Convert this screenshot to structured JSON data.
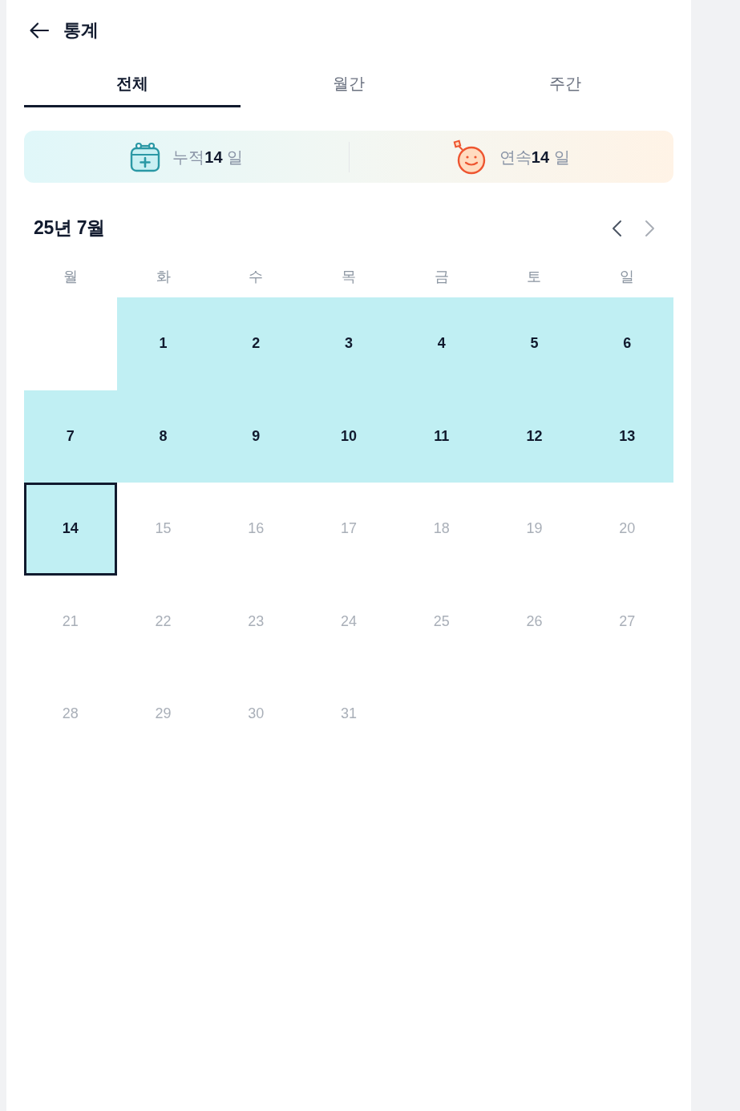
{
  "header": {
    "title": "통계"
  },
  "tabs": [
    {
      "label": "전체",
      "selected": true
    },
    {
      "label": "월간",
      "selected": false
    },
    {
      "label": "주간",
      "selected": false
    }
  ],
  "stats": [
    {
      "kind": "total",
      "text": "누적**14** 일"
    },
    {
      "kind": "streak",
      "text": "연속**14** 일"
    }
  ],
  "calendar": {
    "title": "25년 7월",
    "prev_button": {
      "disabled": false
    },
    "next_button": {
      "disabled": true
    },
    "weekdays": [
      "월",
      "화",
      "수",
      "목",
      "금",
      "토",
      "일"
    ],
    "cells": [
      {
        "kind": "blank"
      },
      {
        "kind": "day",
        "label": "1",
        "done": true,
        "today": false,
        "disabled": false
      },
      {
        "kind": "day",
        "label": "2",
        "done": true,
        "today": false,
        "disabled": false
      },
      {
        "kind": "day",
        "label": "3",
        "done": true,
        "today": false,
        "disabled": false
      },
      {
        "kind": "day",
        "label": "4",
        "done": true,
        "today": false,
        "disabled": false
      },
      {
        "kind": "day",
        "label": "5",
        "done": true,
        "today": false,
        "disabled": false
      },
      {
        "kind": "day",
        "label": "6",
        "done": true,
        "today": false,
        "disabled": false
      },
      {
        "kind": "day",
        "label": "7",
        "done": true,
        "today": false,
        "disabled": false
      },
      {
        "kind": "day",
        "label": "8",
        "done": true,
        "today": false,
        "disabled": false
      },
      {
        "kind": "day",
        "label": "9",
        "done": true,
        "today": false,
        "disabled": false
      },
      {
        "kind": "day",
        "label": "10",
        "done": true,
        "today": false,
        "disabled": false
      },
      {
        "kind": "day",
        "label": "11",
        "done": true,
        "today": false,
        "disabled": false
      },
      {
        "kind": "day",
        "label": "12",
        "done": true,
        "today": false,
        "disabled": false
      },
      {
        "kind": "day",
        "label": "13",
        "done": true,
        "today": false,
        "disabled": false
      },
      {
        "kind": "day",
        "label": "14",
        "done": true,
        "today": true,
        "disabled": false
      },
      {
        "kind": "day",
        "label": "15",
        "done": false,
        "today": false,
        "disabled": true
      },
      {
        "kind": "day",
        "label": "16",
        "done": false,
        "today": false,
        "disabled": true
      },
      {
        "kind": "day",
        "label": "17",
        "done": false,
        "today": false,
        "disabled": true
      },
      {
        "kind": "day",
        "label": "18",
        "done": false,
        "today": false,
        "disabled": true
      },
      {
        "kind": "day",
        "label": "19",
        "done": false,
        "today": false,
        "disabled": true
      },
      {
        "kind": "day",
        "label": "20",
        "done": false,
        "today": false,
        "disabled": true
      },
      {
        "kind": "day",
        "label": "21",
        "done": false,
        "today": false,
        "disabled": true
      },
      {
        "kind": "day",
        "label": "22",
        "done": false,
        "today": false,
        "disabled": true
      },
      {
        "kind": "day",
        "label": "23",
        "done": false,
        "today": false,
        "disabled": true
      },
      {
        "kind": "day",
        "label": "24",
        "done": false,
        "today": false,
        "disabled": true
      },
      {
        "kind": "day",
        "label": "25",
        "done": false,
        "today": false,
        "disabled": true
      },
      {
        "kind": "day",
        "label": "26",
        "done": false,
        "today": false,
        "disabled": true
      },
      {
        "kind": "day",
        "label": "27",
        "done": false,
        "today": false,
        "disabled": true
      },
      {
        "kind": "day",
        "label": "28",
        "done": false,
        "today": false,
        "disabled": true
      },
      {
        "kind": "day",
        "label": "29",
        "done": false,
        "today": false,
        "disabled": true
      },
      {
        "kind": "day",
        "label": "30",
        "done": false,
        "today": false,
        "disabled": true
      },
      {
        "kind": "day",
        "label": "31",
        "done": false,
        "today": false,
        "disabled": true
      }
    ]
  }
}
